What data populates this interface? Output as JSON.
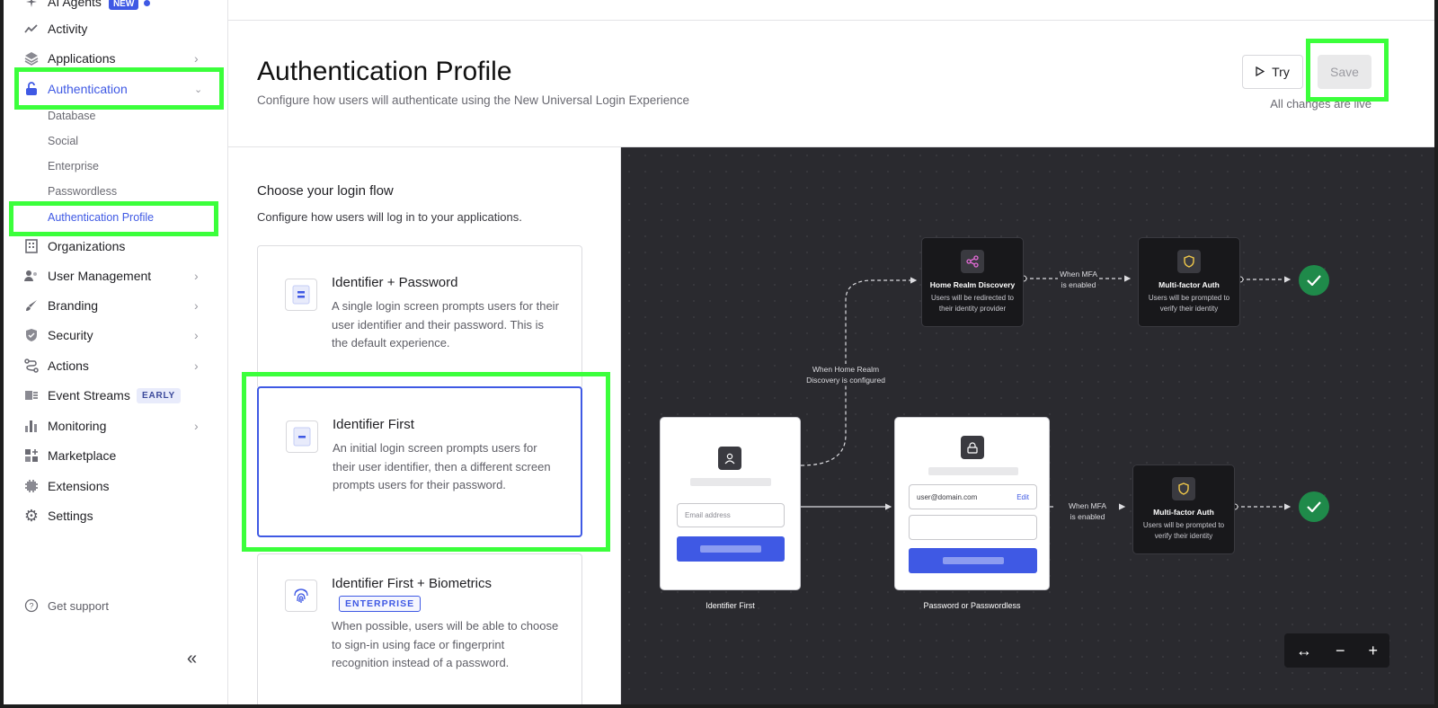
{
  "sidebar": {
    "items": [
      {
        "label": "AI Agents",
        "badge": "NEW"
      },
      {
        "label": "Activity"
      },
      {
        "label": "Applications"
      },
      {
        "label": "Authentication"
      },
      {
        "label": "Organizations"
      },
      {
        "label": "User Management"
      },
      {
        "label": "Branding"
      },
      {
        "label": "Security"
      },
      {
        "label": "Actions"
      },
      {
        "label": "Event Streams",
        "badge": "EARLY"
      },
      {
        "label": "Monitoring"
      },
      {
        "label": "Marketplace"
      },
      {
        "label": "Extensions"
      },
      {
        "label": "Settings"
      }
    ],
    "sub_items": [
      "Database",
      "Social",
      "Enterprise",
      "Passwordless",
      "Authentication Profile"
    ],
    "support": "Get support",
    "collapse": "«"
  },
  "header": {
    "title": "Authentication Profile",
    "subtitle": "Configure how users will authenticate using the New Universal Login Experience",
    "try_label": "Try",
    "save_label": "Save",
    "live_text": "All changes are live"
  },
  "login_flow": {
    "title": "Choose your login flow",
    "description": "Configure how users will log in to your applications.",
    "options": [
      {
        "title": "Identifier + Password",
        "description": "A single login screen prompts users for their user identifier and their password. This is the default experience."
      },
      {
        "title": "Identifier First",
        "description": "An initial login screen prompts users for their user identifier, then a different screen prompts users for their password.",
        "selected": true
      },
      {
        "title": "Identifier First + Biometrics",
        "badge": "ENTERPRISE",
        "description": "When possible, users will be able to choose to sign-in using face or fingerprint recognition instead of a password."
      }
    ]
  },
  "diagram": {
    "hrd_node": {
      "title": "Home Realm Discovery",
      "desc1": "Users will be redirected to",
      "desc2": "their identity provider"
    },
    "mfa_node": {
      "title": "Multi-factor Auth",
      "desc1": "Users will be prompted to",
      "desc2": "verify their identity"
    },
    "edge_mfa": {
      "line1": "When MFA",
      "line2": "is enabled"
    },
    "edge_hrd": {
      "line1": "When Home Realm",
      "line2": "Discovery is configured"
    },
    "screen1": {
      "caption": "Identifier First",
      "placeholder": "Email address"
    },
    "screen2": {
      "caption": "Password or Passwordless",
      "email": "user@domain.com",
      "edit": "Edit"
    }
  },
  "zoom_controls": {
    "fit": "↔",
    "zoom_out": "−",
    "zoom_in": "+"
  },
  "colors": {
    "accent": "#3f59e4",
    "highlight": "#3bff3b",
    "canvas": "#2a2a2f",
    "success": "#1f8a4a"
  }
}
